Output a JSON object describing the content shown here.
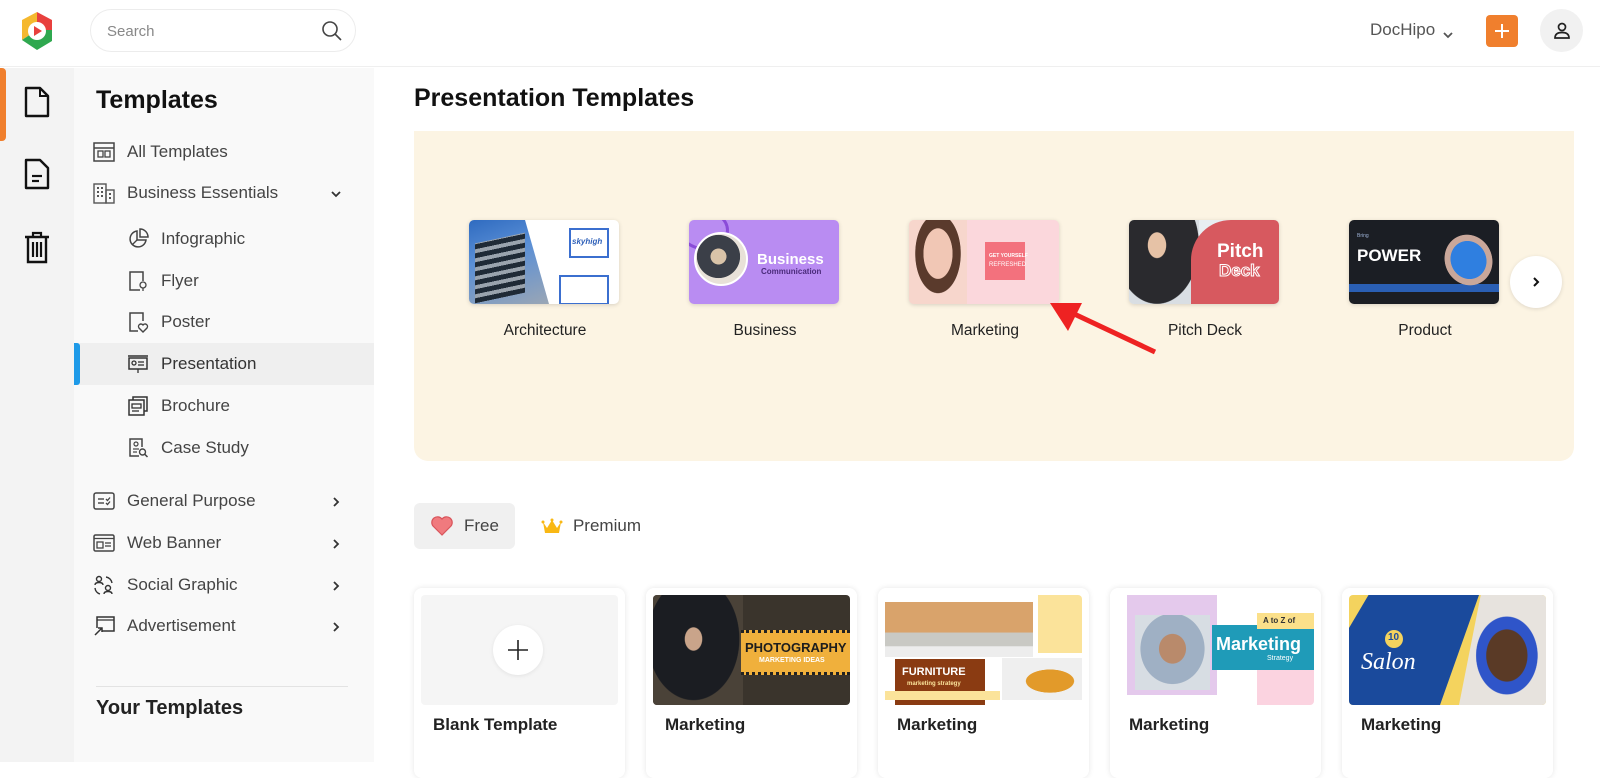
{
  "header": {
    "search_placeholder": "Search",
    "account_name": "DocHipo",
    "add_button_label": "+",
    "brand_colors": {
      "accent": "#f07f2d",
      "active_blue": "#1e9ae8",
      "carousel_bg": "#fcf4e3"
    }
  },
  "rail": {
    "items": [
      {
        "icon": "document-icon",
        "active": true
      },
      {
        "icon": "file-text-icon",
        "active": false
      },
      {
        "icon": "trash-icon",
        "active": false
      }
    ]
  },
  "sidebar": {
    "title": "Templates",
    "items": [
      {
        "label": "All Templates",
        "icon": "layout-icon",
        "level": "top"
      },
      {
        "label": "Business Essentials",
        "icon": "building-icon",
        "level": "top",
        "expanded": true
      },
      {
        "label": "Infographic",
        "icon": "pie-chart-icon",
        "level": "sub"
      },
      {
        "label": "Flyer",
        "icon": "flyer-icon",
        "level": "sub"
      },
      {
        "label": "Poster",
        "icon": "poster-icon",
        "level": "sub"
      },
      {
        "label": "Presentation",
        "icon": "presentation-icon",
        "level": "sub",
        "active": true
      },
      {
        "label": "Brochure",
        "icon": "brochure-icon",
        "level": "sub"
      },
      {
        "label": "Case Study",
        "icon": "case-study-icon",
        "level": "sub"
      },
      {
        "label": "General Purpose",
        "icon": "checklist-icon",
        "level": "top",
        "expanded": false
      },
      {
        "label": "Web Banner",
        "icon": "web-banner-icon",
        "level": "top",
        "expanded": false
      },
      {
        "label": "Social Graphic",
        "icon": "social-icon",
        "level": "top",
        "expanded": false
      },
      {
        "label": "Advertisement",
        "icon": "advertisement-icon",
        "level": "top",
        "expanded": false
      }
    ],
    "your_templates_title": "Your Templates"
  },
  "main": {
    "title": "Presentation Templates",
    "categories": [
      {
        "label": "Architecture",
        "thumb_text": "skyhigh"
      },
      {
        "label": "Business",
        "thumb_text": "Business",
        "thumb_subtext": "Communication"
      },
      {
        "label": "Marketing",
        "thumb_text": "GET YOURSELF",
        "thumb_subtext": "REFRESHED"
      },
      {
        "label": "Pitch Deck",
        "thumb_text": "Pitch",
        "thumb_subtext": "Deck"
      },
      {
        "label": "Product",
        "thumb_text": "POWER",
        "thumb_subtext": "Bring"
      }
    ],
    "filters": [
      {
        "label": "Free",
        "icon": "heart-icon",
        "active": true
      },
      {
        "label": "Premium",
        "icon": "crown-icon",
        "active": false
      }
    ],
    "cards": [
      {
        "label": "Blank Template",
        "type": "blank"
      },
      {
        "label": "Marketing",
        "thumb_text": "PHOTOGRAPHY",
        "thumb_subtext": "MARKETING IDEAS"
      },
      {
        "label": "Marketing",
        "thumb_text": "FURNITURE",
        "thumb_subtext": "marketing strategy"
      },
      {
        "label": "Marketing",
        "thumb_text": "Marketing",
        "thumb_subtext": "A to Z of",
        "thumb_small": "Strategy"
      },
      {
        "label": "Marketing",
        "thumb_text": "Salon",
        "thumb_subtext": "10"
      }
    ]
  }
}
